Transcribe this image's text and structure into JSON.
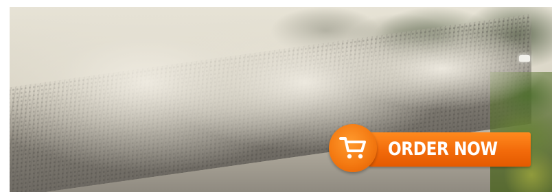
{
  "banner": {
    "photo_subject": "dusty-gravel-road",
    "order_button": {
      "label": "ORDER NOW",
      "icon": "shopping-cart-icon",
      "color": "#f47a12"
    }
  }
}
